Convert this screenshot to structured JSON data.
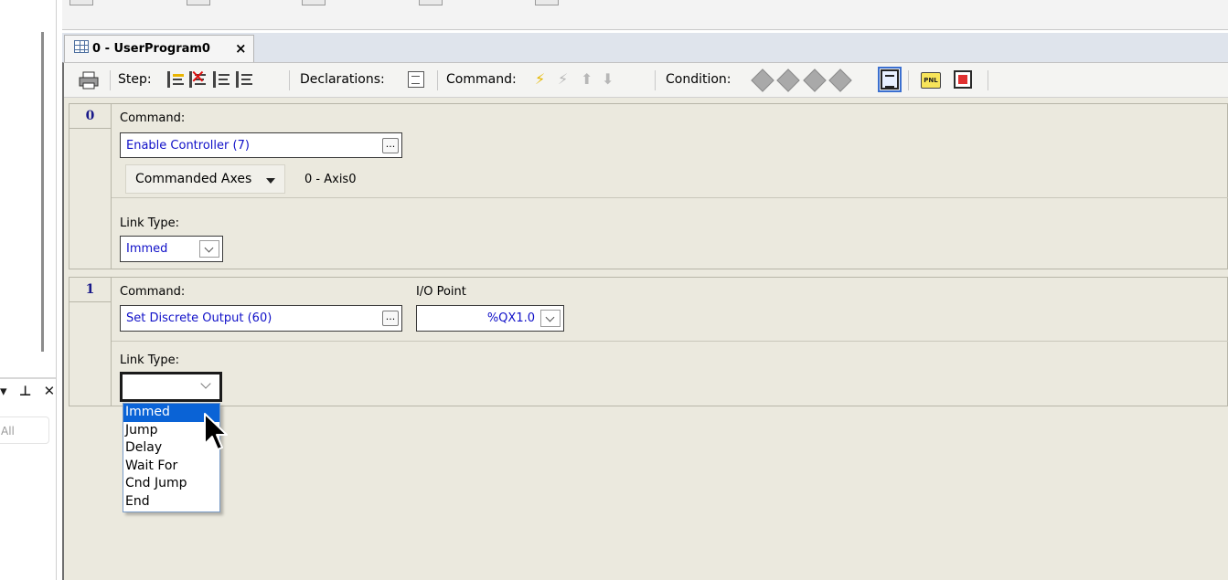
{
  "left_panel": {
    "search_placeholder": "All"
  },
  "tab": {
    "title": "0 - UserProgram0",
    "close_glyph": "×"
  },
  "toolbar": {
    "step_label": "Step:",
    "declarations_label": "Declarations:",
    "command_label": "Command:",
    "condition_label": "Condition:",
    "pnl_icon_text": "PNL"
  },
  "steps": [
    {
      "number": "0",
      "command_label": "Command:",
      "command_value": "Enable Controller (7)",
      "axes_label": "Commanded Axes",
      "axes_value": "0 - Axis0",
      "link_type_label": "Link Type:",
      "link_type_value": "Immed"
    },
    {
      "number": "1",
      "command_label": "Command:",
      "command_value": "Set Discrete Output (60)",
      "io_label": "I/O Point",
      "io_value": "%QX1.0",
      "link_type_label": "Link Type:",
      "link_type_value": ""
    }
  ],
  "link_type_options": [
    "Immed",
    "Jump",
    "Delay",
    "Wait For",
    "Cnd Jump",
    "End"
  ],
  "ellipsis_glyph": "...",
  "dock_buttons": "▾ ⊥ ✕"
}
